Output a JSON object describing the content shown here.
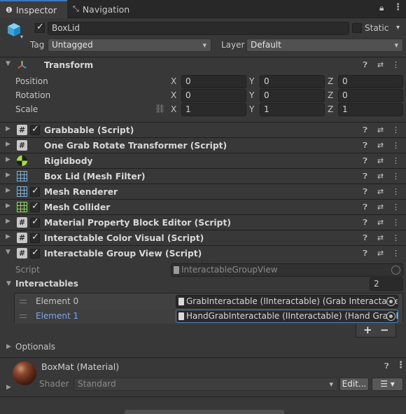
{
  "tabs": [
    {
      "label": "Inspector",
      "icon": "info-icon"
    },
    {
      "label": "Navigation",
      "icon": "navigation-icon"
    }
  ],
  "object": {
    "name": "BoxLid",
    "static_label": "Static",
    "tag_label": "Tag",
    "tag_value": "Untagged",
    "layer_label": "Layer",
    "layer_value": "Default"
  },
  "transform": {
    "title": "Transform",
    "rows": [
      {
        "label": "Position",
        "x": "0",
        "y": "0",
        "z": "0"
      },
      {
        "label": "Rotation",
        "x": "0",
        "y": "0",
        "z": "0"
      },
      {
        "label": "Scale",
        "x": "1",
        "y": "1",
        "z": "1"
      }
    ],
    "axis_x": "X",
    "axis_y": "Y",
    "axis_z": "Z"
  },
  "components": [
    {
      "title": "Grabbable (Script)",
      "icon": "script-icon",
      "checkbox": true
    },
    {
      "title": "One Grab Rotate Transformer (Script)",
      "icon": "script-icon",
      "checkbox": false
    },
    {
      "title": "Rigidbody",
      "icon": "rigidbody-icon",
      "checkbox": false
    },
    {
      "title": "Box Lid (Mesh Filter)",
      "icon": "mesh-filter-icon",
      "checkbox": false
    },
    {
      "title": "Mesh Renderer",
      "icon": "mesh-renderer-icon",
      "checkbox": true
    },
    {
      "title": "Mesh Collider",
      "icon": "mesh-collider-icon",
      "checkbox": true
    },
    {
      "title": "Material Property Block Editor (Script)",
      "icon": "script-icon",
      "checkbox": true
    },
    {
      "title": "Interactable Color Visual (Script)",
      "icon": "script-icon",
      "checkbox": true
    },
    {
      "title": "Interactable Group View (Script)",
      "icon": "script-icon",
      "checkbox": true
    }
  ],
  "group_view": {
    "script_label": "Script",
    "script_value": "InteractableGroupView",
    "interactables_label": "Interactables",
    "interactables_count": "2",
    "elements": [
      {
        "label": "Element 0",
        "value": "GrabInteractable (IInteractable) (Grab Interactable)"
      },
      {
        "label": "Element 1",
        "value": "HandGrabInteractable (IInteractable) (Hand Grab Interactable)"
      }
    ],
    "add_label": "+",
    "remove_label": "−",
    "optionals_label": "Optionals"
  },
  "material": {
    "name": "BoxMat (Material)",
    "shader_label": "Shader",
    "shader_value": "Standard",
    "edit_label": "Edit..."
  },
  "colors": {
    "accent": "#3a79bb",
    "selected_text": "#7aa6e6",
    "background": "#383838"
  }
}
